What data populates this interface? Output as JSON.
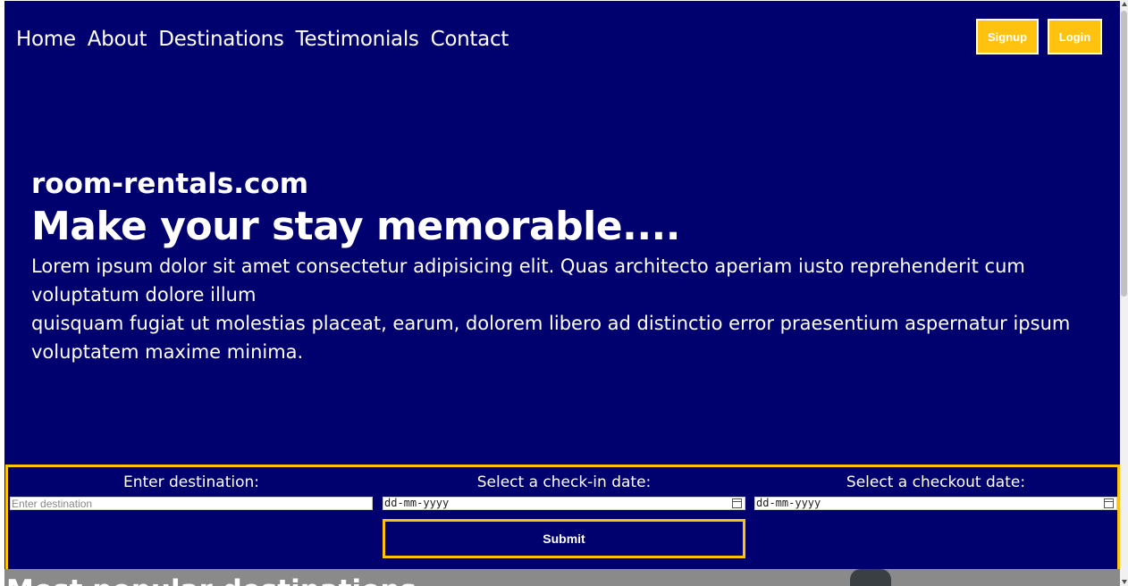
{
  "nav": {
    "items": [
      {
        "label": "Home"
      },
      {
        "label": "About"
      },
      {
        "label": "Destinations"
      },
      {
        "label": "Testimonials"
      },
      {
        "label": "Contact"
      }
    ]
  },
  "auth": {
    "signup_label": "Signup",
    "login_label": "Login"
  },
  "hero": {
    "site_name": "room-rentals.com",
    "headline": "Make your stay memorable....",
    "paragraph1": "Lorem ipsum dolor sit amet consectetur adipisicing elit. Quas architecto aperiam iusto reprehenderit cum voluptatum dolore illum",
    "paragraph2": "quisquam fugiat ut molestias placeat, earum, dolorem libero ad distinctio error praesentium aspernatur ipsum voluptatem maxime minima."
  },
  "booking": {
    "destination_label": "Enter destination:",
    "destination_placeholder": "Enter destination",
    "checkin_label": "Select a check-in date:",
    "checkin_value": "dd-mm-yyyy",
    "checkout_label": "Select a checkout date:",
    "checkout_value": "dd-mm-yyyy",
    "submit_label": "Submit"
  },
  "next_section": {
    "title_peek": "Most popular destinations"
  },
  "colors": {
    "background": "#00006f",
    "accent": "#ffc20e",
    "text": "#ffffff"
  }
}
